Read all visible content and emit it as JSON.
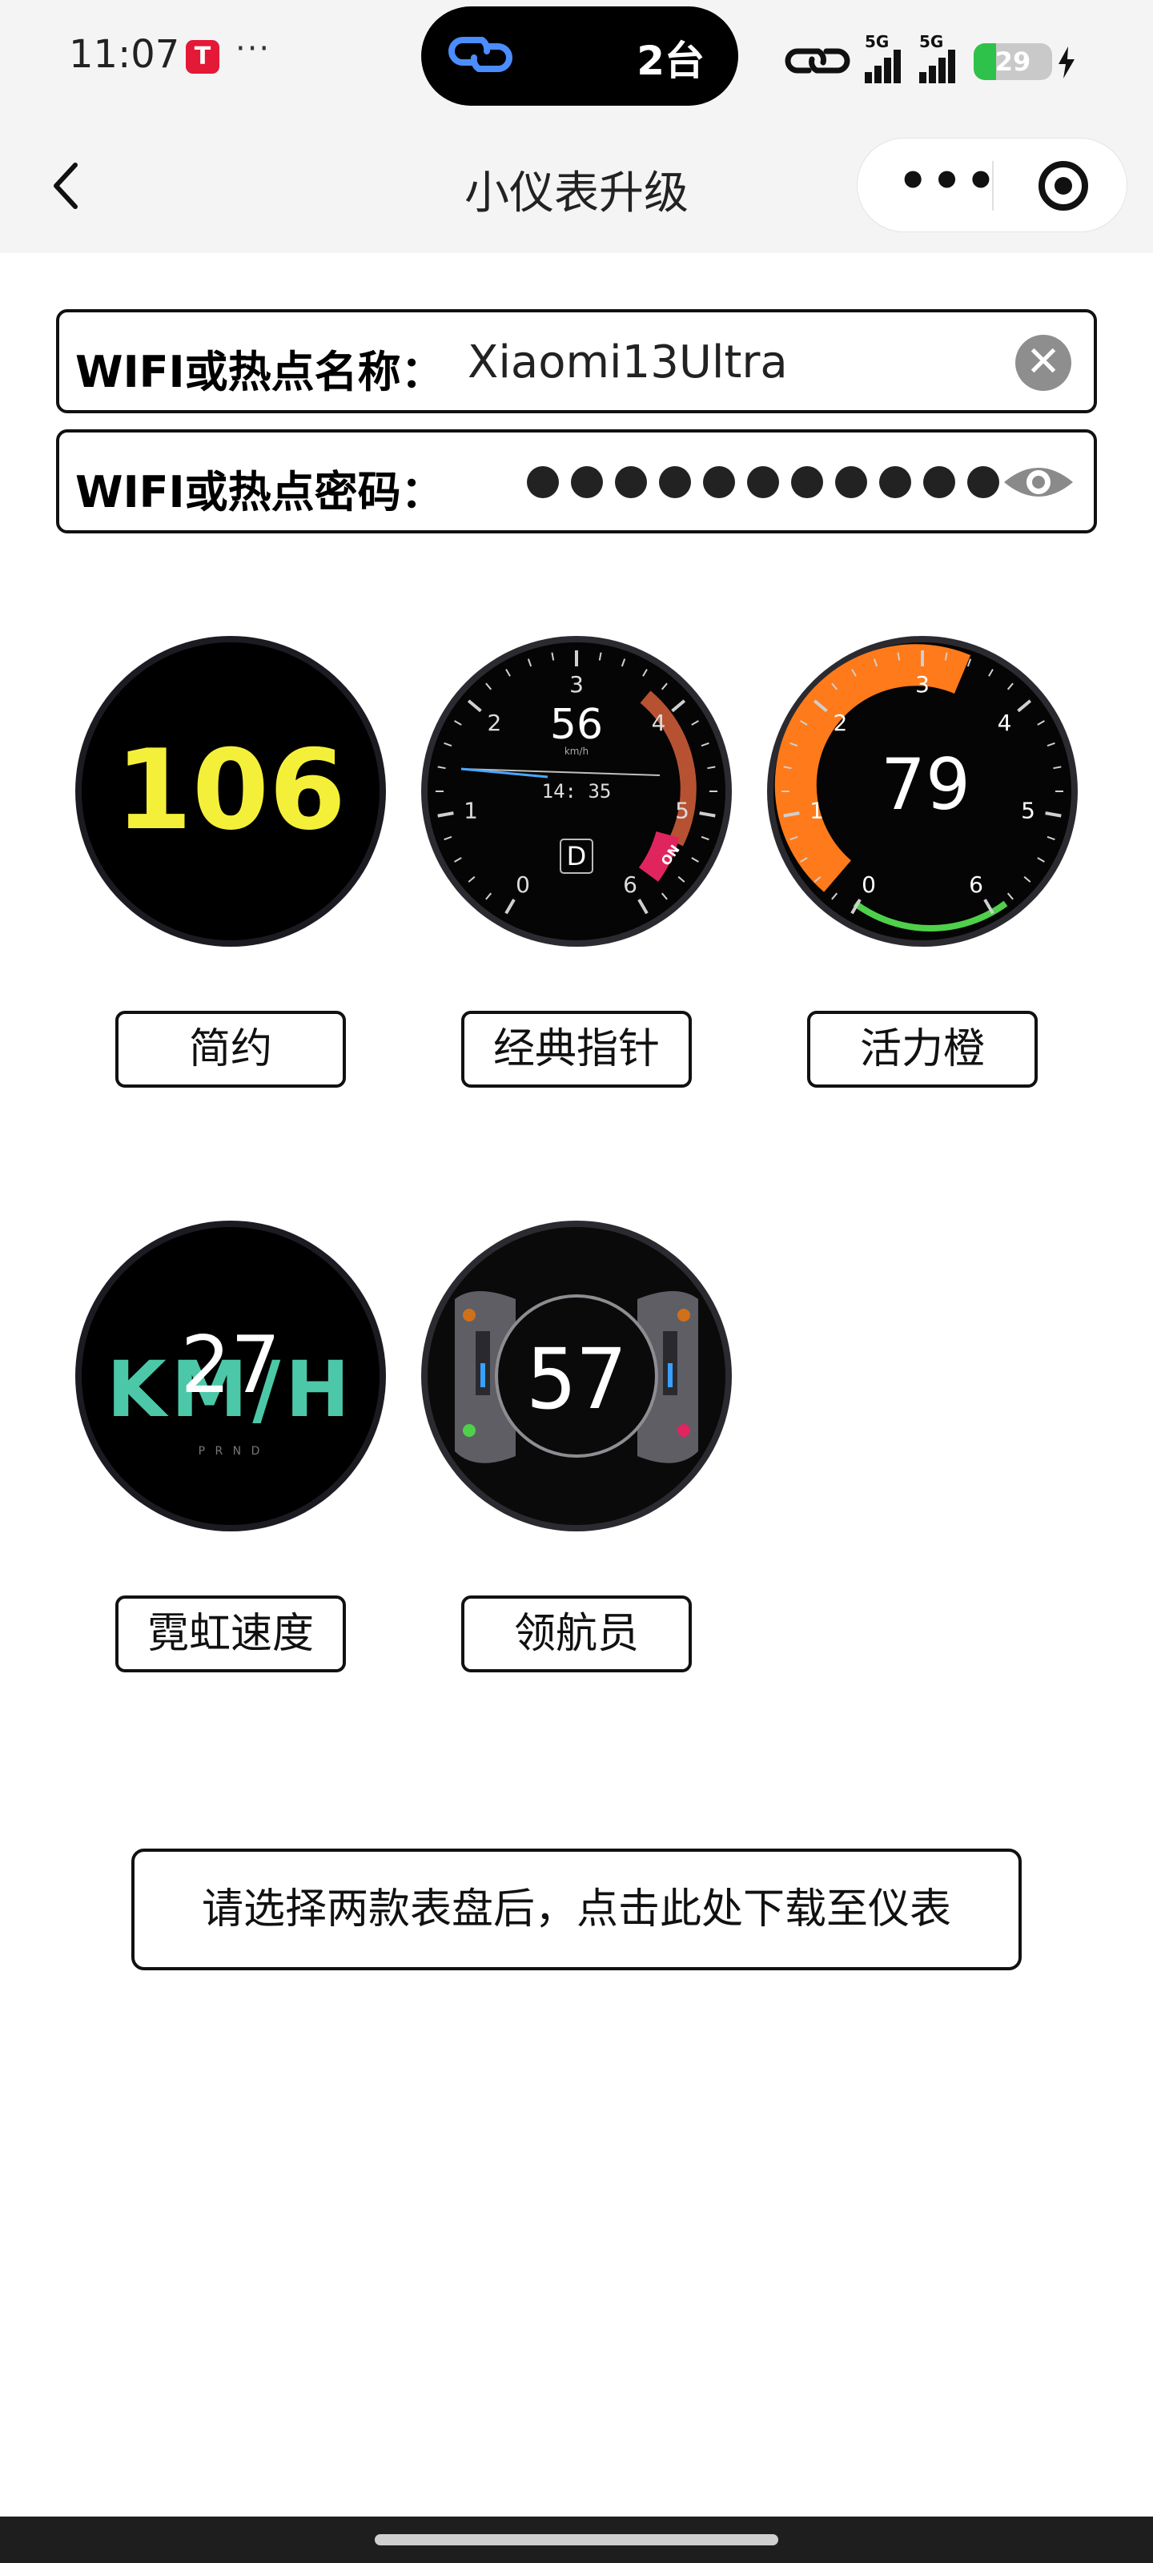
{
  "status_bar": {
    "time": "11:07",
    "app_badge": "T",
    "more": "···",
    "pill_count": "2台",
    "network": [
      "5G",
      "5G"
    ],
    "battery": "29"
  },
  "nav": {
    "title": "小仪表升级"
  },
  "form": {
    "ssid_label": "WIFI或热点名称：",
    "ssid_value": "Xiaomi13Ultra",
    "password_label": "WIFI或热点密码：",
    "password_mask_count": 11
  },
  "dials": [
    {
      "name": "简约",
      "display": "106"
    },
    {
      "name": "经典指针",
      "speed": "56",
      "unit": "km/h",
      "clock": "14: 35",
      "gear": "D",
      "scale": [
        "0",
        "1",
        "2",
        "3",
        "4",
        "5",
        "6"
      ],
      "badge": "ON"
    },
    {
      "name": "活力橙",
      "speed": "79",
      "scale": [
        "0",
        "1",
        "2",
        "3",
        "4",
        "5",
        "6"
      ]
    },
    {
      "name": "霓虹速度",
      "speed": "27",
      "unit_art": "KM/H",
      "gears": "P R N D"
    },
    {
      "name": "领航员",
      "speed": "57"
    }
  ],
  "download_button": "请选择两款表盘后，点击此处下载至仪表",
  "colors": {
    "accent_yellow": "#f4f03a",
    "accent_orange": "#ff7a1a",
    "neon_teal": "#4cc8a8",
    "green_arc": "#4fd04a",
    "red_accent": "#e0245e"
  }
}
